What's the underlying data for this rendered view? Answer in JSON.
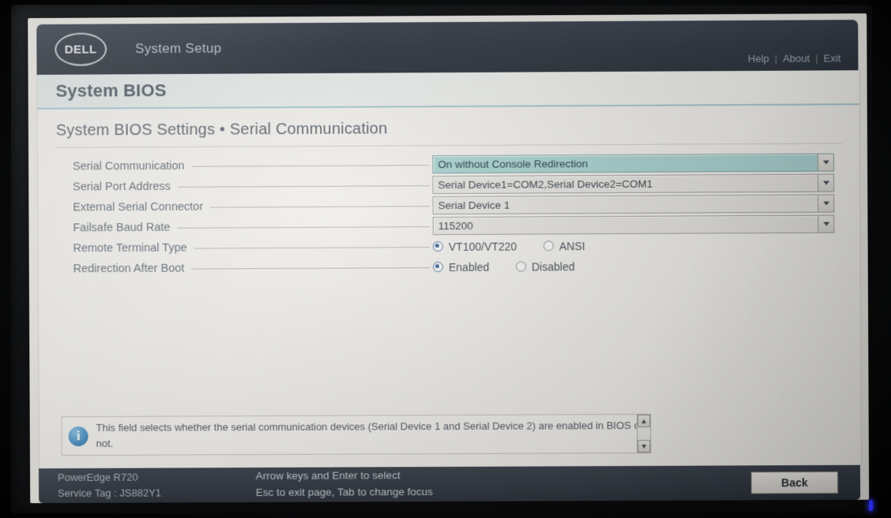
{
  "header": {
    "logo_text": "DELL",
    "app_title": "System Setup",
    "links": [
      {
        "label": "Help"
      },
      {
        "label": "About"
      },
      {
        "label": "Exit"
      }
    ],
    "separator": "|"
  },
  "banner": {
    "title": "System BIOS"
  },
  "page": {
    "section_title": "System BIOS Settings • Serial Communication"
  },
  "settings": [
    {
      "label": "Serial Communication",
      "type": "dropdown",
      "value": "On without Console Redirection",
      "focused": true
    },
    {
      "label": "Serial Port Address",
      "type": "dropdown",
      "value": "Serial Device1=COM2,Serial Device2=COM1",
      "focused": false
    },
    {
      "label": "External Serial Connector",
      "type": "dropdown",
      "value": "Serial Device 1",
      "focused": false
    },
    {
      "label": "Failsafe Baud Rate",
      "type": "dropdown",
      "value": "115200",
      "focused": false
    },
    {
      "label": "Remote Terminal Type",
      "type": "radio",
      "options": [
        {
          "label": "VT100/VT220",
          "selected": true
        },
        {
          "label": "ANSI",
          "selected": false
        }
      ]
    },
    {
      "label": "Redirection After Boot",
      "type": "radio",
      "options": [
        {
          "label": "Enabled",
          "selected": true
        },
        {
          "label": "Disabled",
          "selected": false
        }
      ]
    }
  ],
  "help": {
    "icon": "info-icon",
    "text": "This field selects whether the serial communication devices (Serial Device 1 and Serial Device 2) are enabled in BIOS or not."
  },
  "footer": {
    "model": "PowerEdge R720",
    "service_tag": "Service Tag : JS882Y1",
    "hint_line1": "Arrow keys and Enter to select",
    "hint_line2": "Esc to exit page, Tab to change focus",
    "back_label": "Back"
  },
  "colors": {
    "header_bg": "#2a323d",
    "focus_highlight": "#a4d3d1",
    "banner_accent": "#9ec6cd",
    "screen_bg": "#e9e7e2"
  }
}
